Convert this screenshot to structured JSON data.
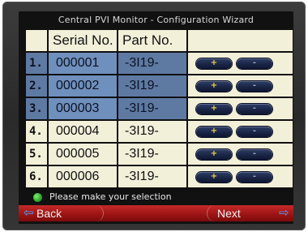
{
  "window": {
    "title": "Central PVI Monitor - Configuration Wizard"
  },
  "table": {
    "headers": {
      "serial": "Serial No.",
      "part": "Part No."
    },
    "rows": [
      {
        "index": "1.",
        "serial": "000001",
        "part": "-3I19-",
        "plus": "+",
        "minus": "-"
      },
      {
        "index": "2.",
        "serial": "000002",
        "part": "-3I19-",
        "plus": "+",
        "minus": "-"
      },
      {
        "index": "3.",
        "serial": "000003",
        "part": "-3I19-",
        "plus": "+",
        "minus": "-"
      },
      {
        "index": "4.",
        "serial": "000004",
        "part": "-3I19-",
        "plus": "+",
        "minus": "-"
      },
      {
        "index": "5.",
        "serial": "000005",
        "part": "-3I19-",
        "plus": "+",
        "minus": "-"
      },
      {
        "index": "6.",
        "serial": "000006",
        "part": "-3I19-",
        "plus": "+",
        "minus": "-"
      }
    ]
  },
  "status": {
    "text": "Please make your selection",
    "indicator_color": "#2ea52a"
  },
  "nav": {
    "back_label": "Back",
    "next_label": "Next"
  },
  "colors": {
    "accent_nav": "#b01d1d",
    "row_selected": "#5e7aa3",
    "cell_background": "#f3f0d9"
  }
}
